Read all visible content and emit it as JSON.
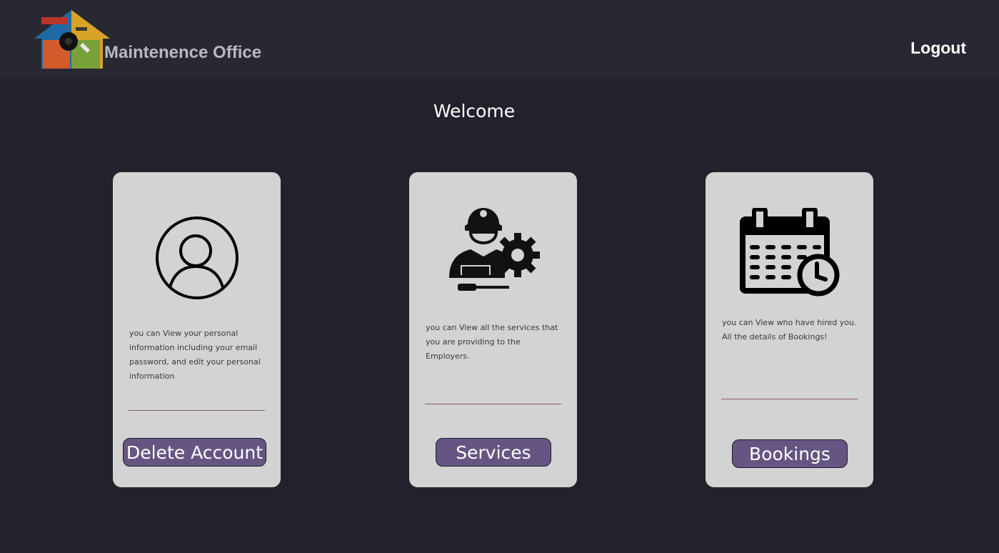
{
  "header": {
    "brand": "Maintenence Office",
    "logout_label": "Logout"
  },
  "welcome": "Welcome",
  "cards": [
    {
      "icon": "user-profile-icon",
      "description": "you can View your personal information including your email password, and edit your personal information",
      "button_label": "Delete Account"
    },
    {
      "icon": "worker-gear-icon",
      "description": "you can View all the services that you are providing to the Employers.",
      "button_label": "Services"
    },
    {
      "icon": "calendar-clock-icon",
      "description": "you can View who have hired you. All the details of Bookings!",
      "button_label": "Bookings"
    }
  ],
  "colors": {
    "background": "#22222c",
    "header": "#282832",
    "card": "#d3d3d3",
    "button": "#665582",
    "divider": "#8a5a60"
  }
}
